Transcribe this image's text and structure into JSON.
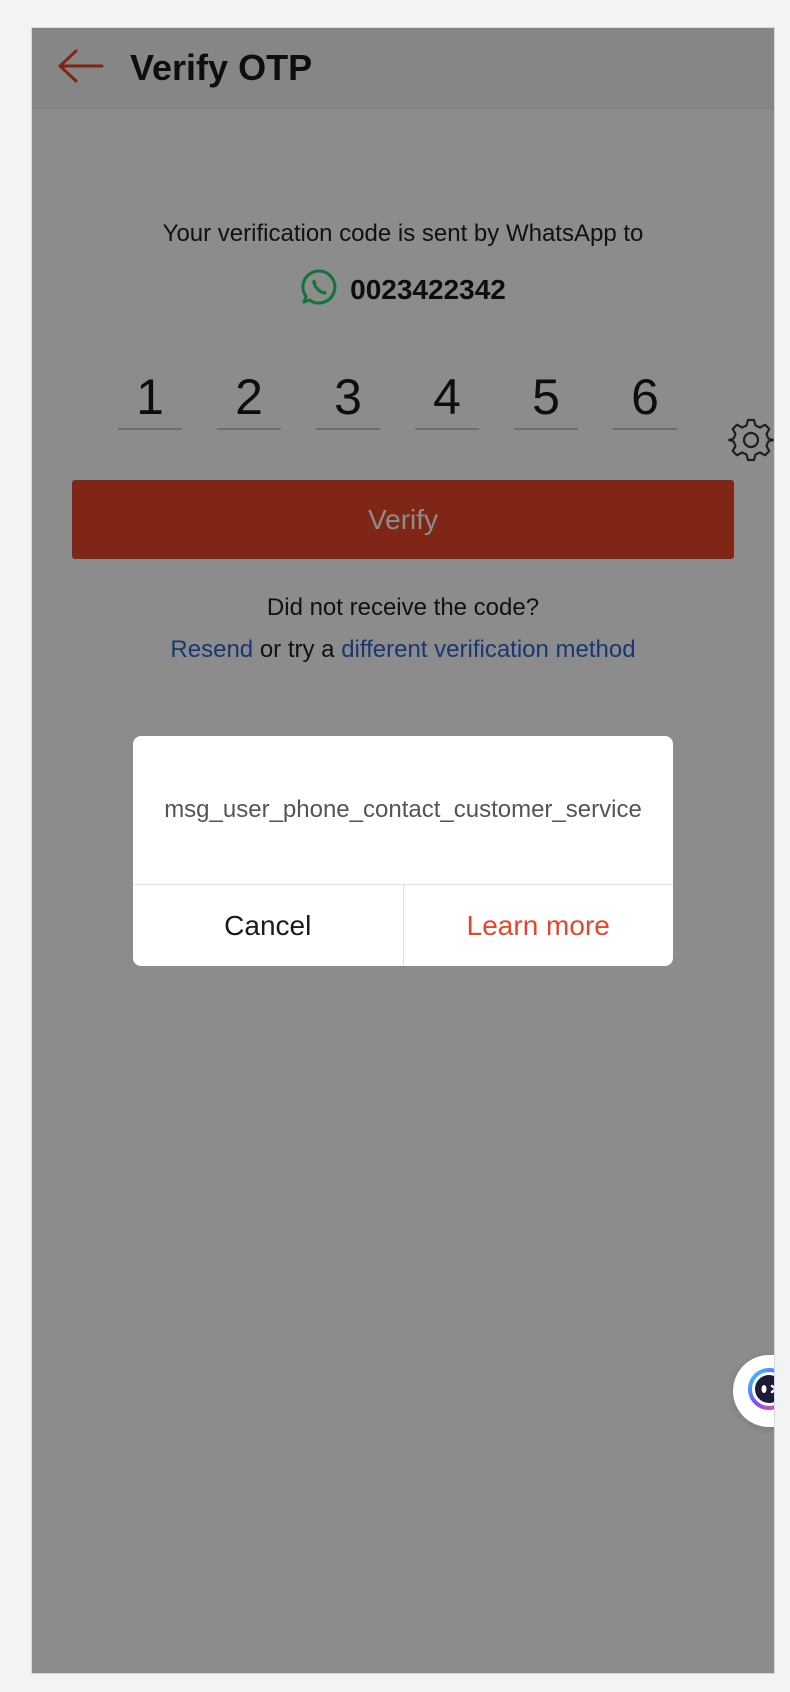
{
  "header": {
    "back_icon": "arrow-left-icon",
    "title": "Verify OTP"
  },
  "verification": {
    "sent_text": "Your verification code is sent by WhatsApp to",
    "channel_icon": "whatsapp-icon",
    "phone_number": "0023422342",
    "otp_digits": [
      "1",
      "2",
      "3",
      "4",
      "5",
      "6"
    ],
    "verify_label": "Verify",
    "no_code_text": "Did not receive the code?",
    "resend_label": "Resend",
    "or_text": " or try a ",
    "alt_method_label": "different verification method"
  },
  "dialog": {
    "message": "msg_user_phone_contact_customer_service",
    "cancel_label": "Cancel",
    "learn_more_label": "Learn more"
  },
  "colors": {
    "accent": "#e8452b",
    "link": "#2f64d4",
    "whatsapp": "#25d366"
  }
}
